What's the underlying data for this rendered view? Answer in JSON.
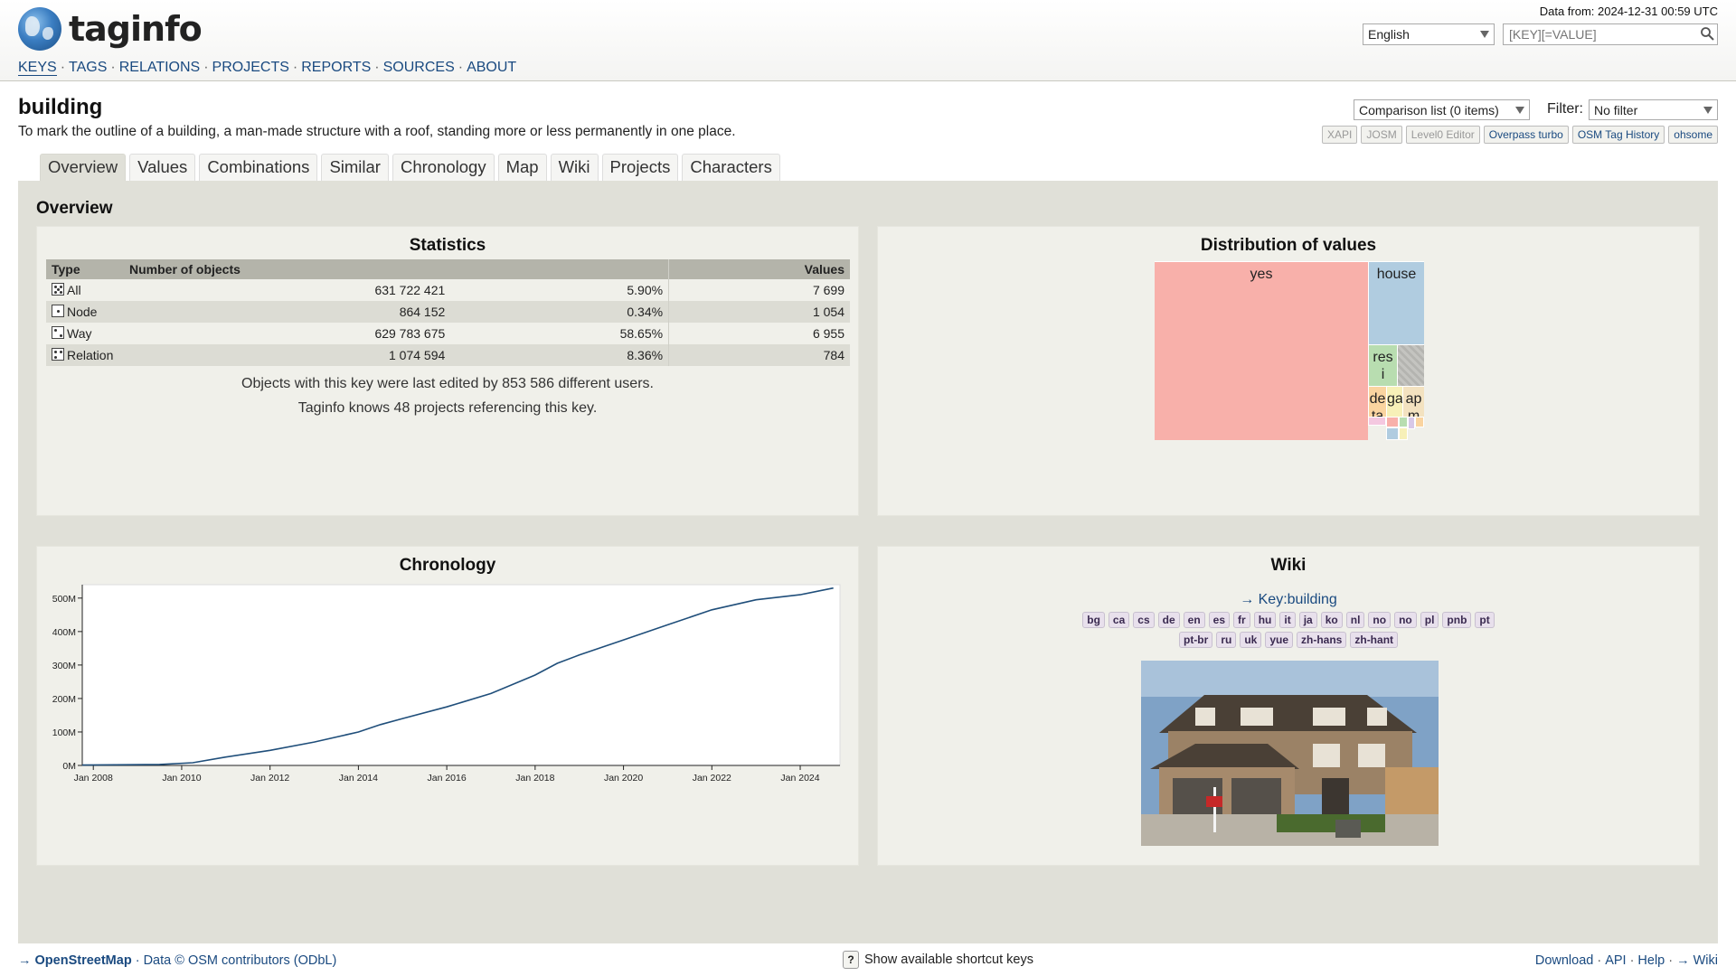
{
  "header": {
    "logo_text": "taginfo",
    "data_from": "Data from: 2024-12-31 00:59 UTC",
    "language": "English",
    "search_placeholder": "[KEY][=VALUE]",
    "nav": [
      "KEYS",
      "TAGS",
      "RELATIONS",
      "PROJECTS",
      "REPORTS",
      "SOURCES",
      "ABOUT"
    ],
    "nav_active": "KEYS"
  },
  "page": {
    "title": "building",
    "description": "To mark the outline of a building, a man-made structure with a roof, standing more or less permanently in one place.",
    "comparison": "Comparison list (0 items)",
    "filter_label": "Filter:",
    "filter_value": "No filter",
    "ext_buttons": [
      {
        "label": "XAPI",
        "enabled": false
      },
      {
        "label": "JOSM",
        "enabled": false
      },
      {
        "label": "Level0 Editor",
        "enabled": false
      },
      {
        "label": "Overpass turbo",
        "enabled": true
      },
      {
        "label": "OSM Tag History",
        "enabled": true
      },
      {
        "label": "ohsome",
        "enabled": true
      }
    ]
  },
  "tabs": [
    "Overview",
    "Values",
    "Combinations",
    "Similar",
    "Chronology",
    "Map",
    "Wiki",
    "Projects",
    "Characters"
  ],
  "overview": {
    "title": "Overview",
    "statistics": {
      "title": "Statistics",
      "headers": [
        "Type",
        "Number of objects",
        "Values"
      ],
      "rows": [
        {
          "type": "All",
          "count": "631 722 421",
          "percent": "5.90%",
          "values": "7 699"
        },
        {
          "type": "Node",
          "count": "864 152",
          "percent": "0.34%",
          "values": "1 054"
        },
        {
          "type": "Way",
          "count": "629 783 675",
          "percent": "58.65%",
          "values": "6 955"
        },
        {
          "type": "Relation",
          "count": "1 074 594",
          "percent": "8.36%",
          "values": "784"
        }
      ],
      "users_line": "Objects with this key were last edited by 853 586 different users.",
      "projects_line": "Taginfo knows 48 projects referencing this key."
    },
    "distribution": {
      "title": "Distribution of values",
      "cells": [
        {
          "label": "yes",
          "color": "#f8b0aa"
        },
        {
          "label": "house",
          "color": "#b0cce0"
        },
        {
          "label": "res\ni",
          "color": "#b8ddb0"
        },
        {
          "label": "",
          "color": "#c8c8c4"
        },
        {
          "label": "de\nta",
          "color": "#fad4a0"
        },
        {
          "label": "ga",
          "color": "#f7f0b8"
        },
        {
          "label": "ap\nm",
          "color": "#f3e2c0"
        }
      ]
    },
    "chronology": {
      "title": "Chronology"
    },
    "wiki": {
      "title": "Wiki",
      "link": "→ Key:building",
      "langs_row1": [
        "bg",
        "ca",
        "cs",
        "de",
        "en",
        "es",
        "fr",
        "hu",
        "it",
        "ja",
        "ko",
        "nl",
        "no",
        "no",
        "pl",
        "pnb",
        "pt"
      ],
      "langs_row2": [
        "pt-br",
        "ru",
        "uk",
        "yue",
        "zh-hans",
        "zh-hant"
      ]
    }
  },
  "chart_data": {
    "type": "line",
    "title": "Chronology",
    "x": [
      "2007-10",
      "2008-07",
      "2009-07",
      "2010-04",
      "2011-01",
      "2012-01",
      "2013-01",
      "2014-01",
      "2014-07",
      "2015-01",
      "2016-01",
      "2017-01",
      "2018-01",
      "2018-07",
      "2019-01",
      "2020-01",
      "2021-01",
      "2022-01",
      "2023-01",
      "2024-01",
      "2024-10"
    ],
    "series": [
      {
        "values": [
          1,
          2,
          3,
          8,
          25,
          45,
          70,
          100,
          122,
          140,
          175,
          215,
          270,
          305,
          330,
          375,
          420,
          465,
          495,
          510,
          530
        ]
      }
    ],
    "y_unit": "M",
    "yticks": [
      "0M",
      "100M",
      "200M",
      "300M",
      "400M",
      "500M"
    ],
    "xticks": [
      "Jan 2008",
      "Jan 2010",
      "Jan 2012",
      "Jan 2014",
      "Jan 2016",
      "Jan 2018",
      "Jan 2020",
      "Jan 2022",
      "Jan 2024"
    ],
    "ylim": [
      0,
      540
    ],
    "line_color": "#1f4e7a"
  },
  "footer": {
    "osm_link": "→ OpenStreetMap",
    "data_credit": "· Data © OSM contributors (ODbL)",
    "shortcut_key": "?",
    "shortcut_text": "Show available shortcut keys",
    "links": [
      "Download",
      "API",
      "Help",
      "→ Wiki"
    ]
  }
}
